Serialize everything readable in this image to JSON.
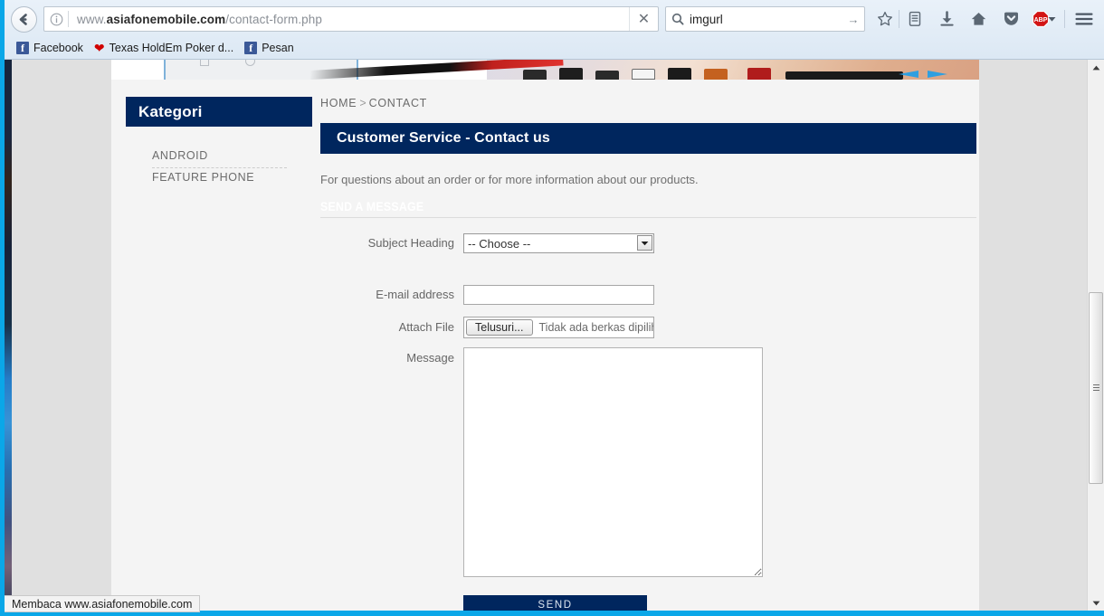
{
  "browser": {
    "back_icon": "back-arrow-icon",
    "info_icon": "info-icon",
    "url_prefix": "www.",
    "url_host": "asiafonemobile.com",
    "url_path": "/contact-form.php",
    "stop_icon": "close-icon",
    "search_icon": "search-icon",
    "search_value": "imgurl",
    "search_go_icon": "go-arrow-icon",
    "toolbar_icons": [
      {
        "name": "bookmark-star-icon",
        "glyph": "☆"
      },
      {
        "name": "reading-list-icon",
        "glyph": "☰"
      },
      {
        "name": "downloads-icon",
        "glyph": "⬇"
      },
      {
        "name": "home-icon",
        "glyph": "⌂"
      },
      {
        "name": "pocket-icon",
        "glyph": "▼"
      },
      {
        "name": "adblock-plus-icon",
        "glyph": "ABP"
      },
      {
        "name": "menu-hamburger-icon",
        "glyph": "☰"
      }
    ],
    "bookmarks": [
      {
        "label": "Facebook",
        "icon": "facebook-icon"
      },
      {
        "label": "Texas HoldEm Poker d...",
        "icon": "heart-icon"
      },
      {
        "label": "Pesan",
        "icon": "facebook-icon"
      }
    ]
  },
  "status_bar": {
    "text": "Membaca www.asiafonemobile.com"
  },
  "sidebar": {
    "title": "Kategori",
    "items": [
      {
        "label": "ANDROID"
      },
      {
        "label": "FEATURE PHONE"
      }
    ]
  },
  "main": {
    "breadcrumb": {
      "home": "HOME",
      "separator": ">",
      "current": "CONTACT"
    },
    "page_title": "Customer Service - Contact us",
    "intro": "For questions about an order or for more information about our products.",
    "section_label": "SEND A MESSAGE",
    "form": {
      "subject": {
        "label": "Subject Heading",
        "value": "-- Choose --",
        "options": [
          "-- Choose --"
        ]
      },
      "email": {
        "label": "E-mail address",
        "value": "",
        "placeholder": ""
      },
      "attach": {
        "label": "Attach File",
        "button_label": "Telusuri...",
        "file_status": "Tidak ada berkas dipilih"
      },
      "message": {
        "label": "Message",
        "value": "",
        "placeholder": ""
      },
      "submit_label": "SEND"
    }
  },
  "colors": {
    "navy": "#00265e",
    "page_bg": "#e0e0e0",
    "content_bg": "#f4f4f4",
    "frame_cyan": "#0aa7e8"
  },
  "scrollbar": {
    "up_icon": "scroll-up-icon",
    "down_icon": "scroll-down-icon"
  }
}
